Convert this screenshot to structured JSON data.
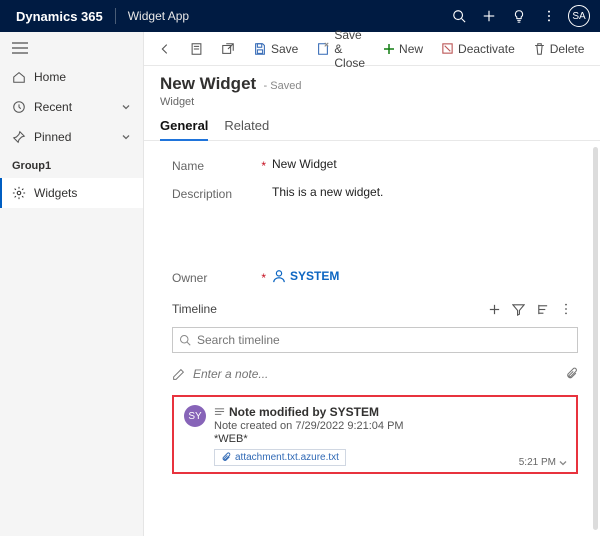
{
  "topbar": {
    "brand": "Dynamics 365",
    "app": "Widget App",
    "avatar": "SA"
  },
  "sidebar": {
    "home": "Home",
    "recent": "Recent",
    "pinned": "Pinned",
    "group": "Group1",
    "widgets": "Widgets"
  },
  "cmd": {
    "save": "Save",
    "save_close": "Save & Close",
    "new": "New",
    "deactivate": "Deactivate",
    "delete": "Delete"
  },
  "header": {
    "title": "New Widget",
    "saved": "- Saved",
    "subtitle": "Widget"
  },
  "tabs": {
    "general": "General",
    "related": "Related"
  },
  "fields": {
    "name_label": "Name",
    "name_value": "New Widget",
    "desc_label": "Description",
    "desc_value": "This is a new widget.",
    "owner_label": "Owner",
    "owner_value": "SYSTEM"
  },
  "timeline": {
    "label": "Timeline",
    "search_placeholder": "Search timeline",
    "note_placeholder": "Enter a note..."
  },
  "note": {
    "avatar": "SY",
    "title": "Note modified by SYSTEM",
    "created": "Note created on 7/29/2022 9:21:04 PM",
    "web": "*WEB*",
    "attachment": "attachment.txt.azure.txt",
    "time": "5:21 PM"
  }
}
